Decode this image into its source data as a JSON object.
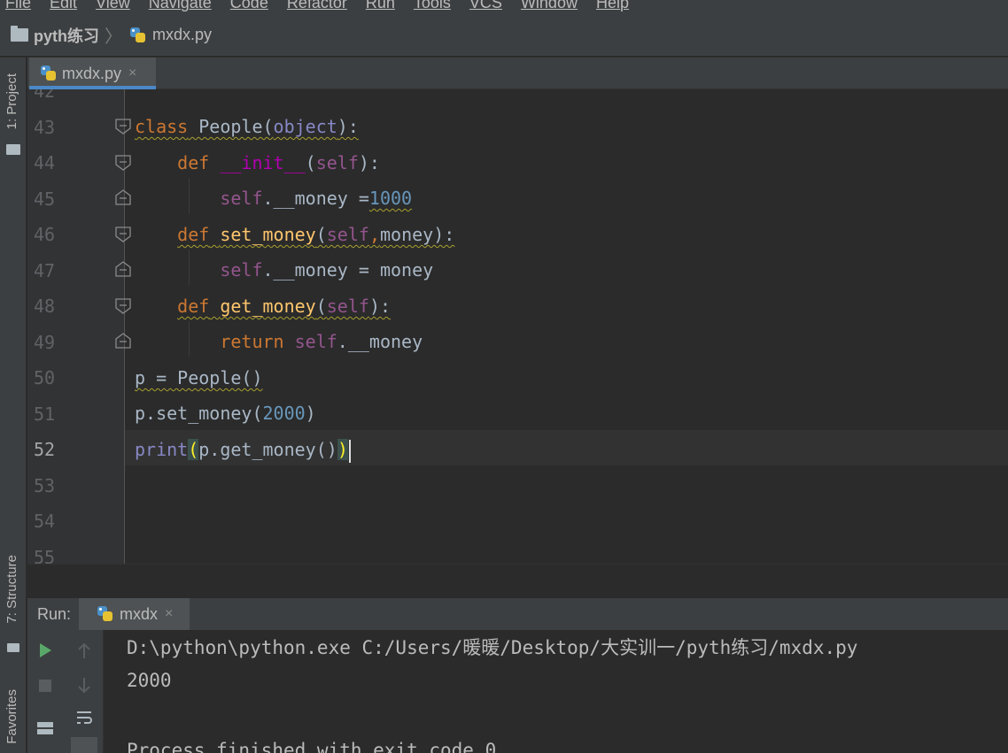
{
  "menu": [
    "File",
    "Edit",
    "View",
    "Navigate",
    "Code",
    "Refactor",
    "Run",
    "Tools",
    "VCS",
    "Window",
    "Help"
  ],
  "breadcrumb": {
    "project": "pyth练习",
    "file": "mxdx.py"
  },
  "left_tabs": {
    "project": "1: Project",
    "structure": "7: Structure",
    "favorites": "Favorites"
  },
  "editor_tab": {
    "label": "mxdx.py",
    "close": "×"
  },
  "line_numbers": [
    "42",
    "43",
    "44",
    "45",
    "46",
    "47",
    "48",
    "49",
    "50",
    "51",
    "52",
    "53",
    "54",
    "55"
  ],
  "current_line": "52",
  "run_panel": {
    "label": "Run:",
    "tab_label": "mxdx",
    "close": "×"
  },
  "console": {
    "command": "D:\\python\\python.exe C:/Users/暖暖/Desktop/大实训一/pyth练习/mxdx.py",
    "output": "2000",
    "exit_message": "Process finished with exit code 0"
  },
  "icons": [
    "folder-icon",
    "python-file-icon",
    "run-icon",
    "stop-icon",
    "up-arrow-icon",
    "down-arrow-icon",
    "soft-wrap-icon",
    "layout-icon",
    "fold-icon"
  ],
  "colors": {
    "keyword": "#cc7832",
    "self": "#94558d",
    "builtin": "#8888c6",
    "number": "#6897bb",
    "function": "#ffc66d",
    "accent": "#4a88c7",
    "run_green": "#59a869"
  }
}
